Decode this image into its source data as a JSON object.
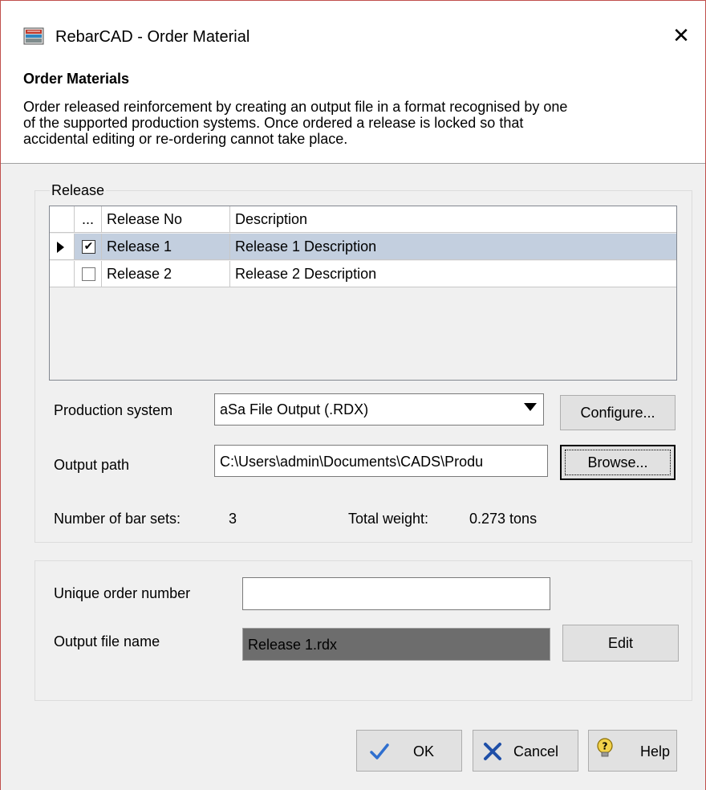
{
  "window": {
    "title": "RebarCAD - Order Material",
    "close_glyph": "✕"
  },
  "header": {
    "title": "Order Materials",
    "description": "Order released reinforcement by creating an output file in a format recognised by one\nof the supported production systems. Once ordered a release is locked so that\naccidental editing or re-ordering cannot take place."
  },
  "release_group": {
    "legend": "Release",
    "grid": {
      "columns": [
        "",
        "...",
        "Release No",
        "Description"
      ],
      "rows": [
        {
          "current": true,
          "checked": true,
          "release_no": "Release 1",
          "description": "Release 1 Description",
          "check_glyph": "✔"
        },
        {
          "current": false,
          "checked": false,
          "release_no": "Release 2",
          "description": "Release 2 Description",
          "check_glyph": ""
        }
      ]
    },
    "production_system_label": "Production system",
    "production_system_value": "aSa File Output (.RDX)",
    "configure_button": "Configure...",
    "output_path_label": "Output path",
    "output_path_value": "C:\\Users\\admin\\Documents\\CADS\\Produ",
    "browse_button": "Browse...",
    "bar_sets_label": "Number of bar sets:",
    "bar_sets_value": "3",
    "total_weight_label": "Total weight:",
    "total_weight_value": "0.273 tons"
  },
  "order_group": {
    "order_number_label": "Unique order number",
    "order_number_value": "",
    "output_file_label": "Output file name",
    "output_file_value": "Release 1.rdx",
    "edit_button": "Edit"
  },
  "buttons": {
    "ok": "OK",
    "cancel": "Cancel",
    "help": "Help"
  },
  "icons": {
    "app": "rebarcad-app-icon",
    "ok": "checkmark-icon",
    "cancel": "x-icon",
    "help": "help-bulb-icon"
  }
}
